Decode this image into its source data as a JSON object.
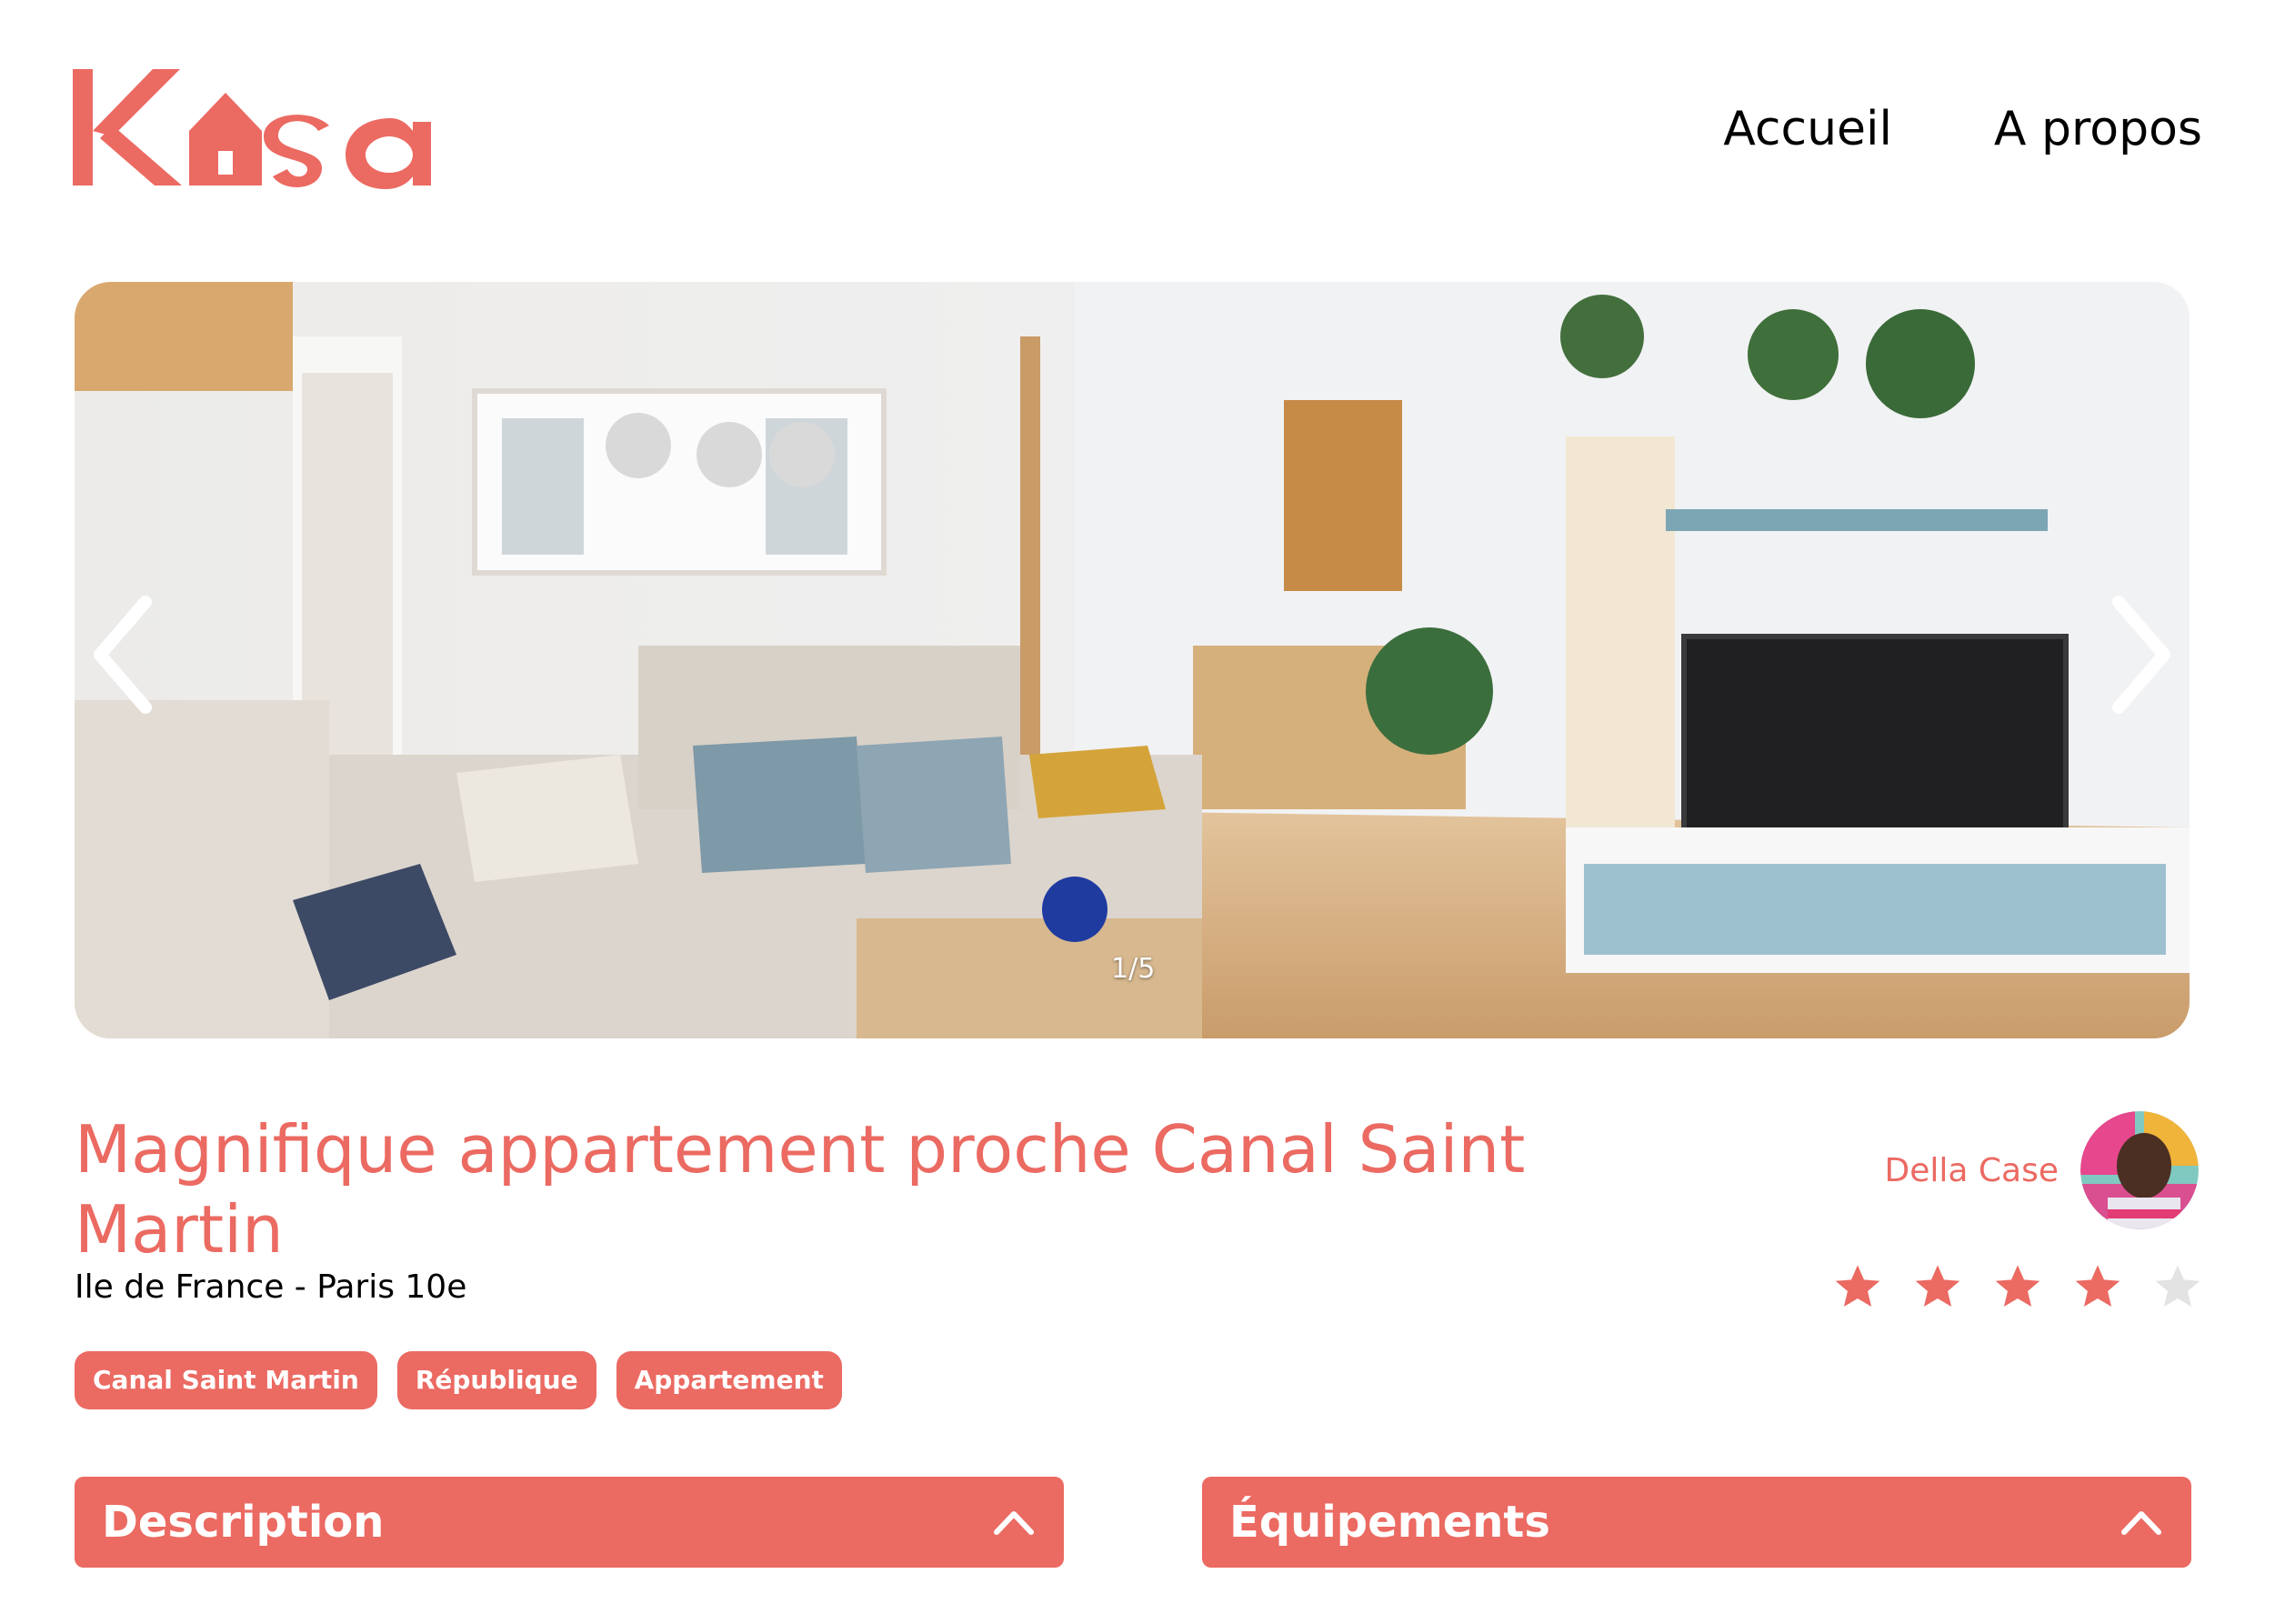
{
  "brand": {
    "name": "Kasa",
    "accent": "#eb6a62"
  },
  "nav": {
    "home": "Accueil",
    "about": "A propos"
  },
  "carousel": {
    "counter": "1/5",
    "prev_icon": "chevron-left-icon",
    "next_icon": "chevron-right-icon"
  },
  "listing": {
    "title": "Magnifique appartement proche Canal Saint Martin",
    "location": "Ile de France - Paris 10e",
    "tags": [
      "Canal Saint Martin",
      "République",
      "Appartement"
    ]
  },
  "host": {
    "name": "Della Case"
  },
  "rating": {
    "value": 4,
    "max": 5,
    "filled_color": "#eb6a62",
    "empty_color": "#e3e3e3"
  },
  "sections": {
    "description": "Description",
    "equipments": "Équipements"
  }
}
